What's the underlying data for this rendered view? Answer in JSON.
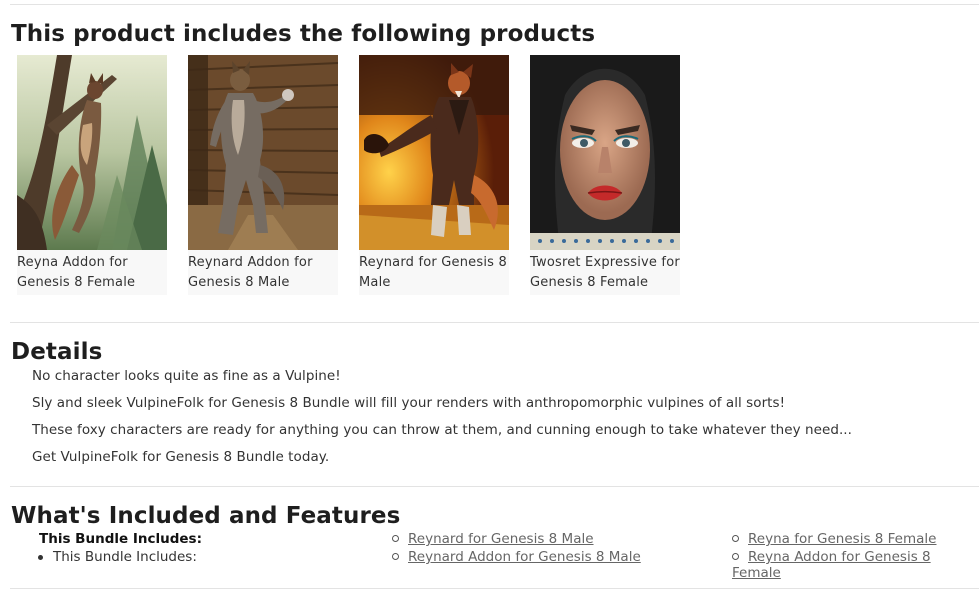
{
  "products_section": {
    "heading": "This product includes the following products",
    "items": [
      {
        "title_line1": "Reyna Addon for",
        "title_line2": "Genesis 8 Female",
        "image": "fox-woman-hanging-from-tree-image"
      },
      {
        "title_line1": "Reynard Addon for",
        "title_line2": "Genesis 8 Male",
        "image": "grey-fox-man-in-wooden-room-image"
      },
      {
        "title_line1": "Reynard for Genesis 8",
        "title_line2": "Male",
        "image": "fox-man-in-coat-by-fire-image"
      },
      {
        "title_line1": "Twosret Expressive for",
        "title_line2": "Genesis 8 Female",
        "image": "woman-face-expression-image"
      }
    ]
  },
  "details_section": {
    "heading": "Details",
    "paragraphs": [
      "No character looks quite as fine as a Vulpine!",
      "Sly and sleek VulpineFolk for Genesis 8 Bundle will fill your renders with anthropomorphic vulpines of all sorts!",
      "These foxy characters are ready for anything you can throw at them, and cunning enough to take whatever they need...",
      "Get VulpineFolk for Genesis 8 Bundle today."
    ]
  },
  "included_section": {
    "heading": "What's Included and Features",
    "bold_label": "This Bundle Includes:",
    "bullet_label": "This Bundle Includes:",
    "links_col1": [
      "Reynard for Genesis 8 Male",
      "Reynard Addon for Genesis 8 Male"
    ],
    "links_col2": [
      "Reyna for Genesis 8 Female",
      "Reyna Addon for Genesis 8 Female"
    ]
  }
}
